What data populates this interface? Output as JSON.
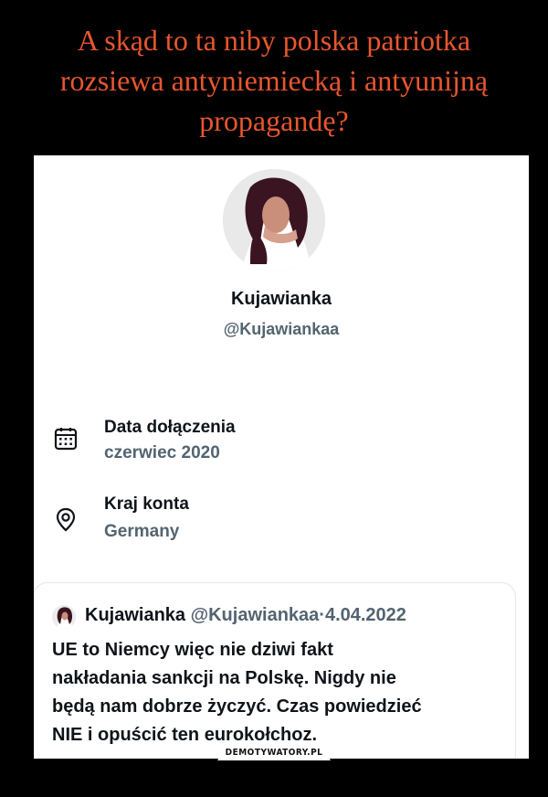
{
  "headline": {
    "lines": [
      "A skąd to ta niby polska patriotka",
      "rozsiewa antyniemiecką i antyunijną",
      "propagandę?"
    ],
    "color": "#e8562f"
  },
  "profile": {
    "name": "Kujawianka",
    "handle": "@Kujawiankaa",
    "joined_label": "Data dołączenia",
    "joined_value": "czerwiec 2020",
    "country_label": "Kraj konta",
    "country_value": "Germany"
  },
  "tweet": {
    "name": "Kujawianka",
    "handle": "@Kujawiankaa",
    "separator": "·",
    "date": "4.04.2022",
    "lines": [
      "UE to Niemcy więc nie dziwi fakt",
      "nakładania sankcji na Polskę. Nigdy nie",
      "będą nam dobrze życzyć. Czas powiedzieć",
      "NIE i opuścić ten eurokołchoz."
    ]
  },
  "watermark": "DEMOTYWATORY.PL",
  "icons": {
    "joined": "calendar-icon",
    "country": "location-pin-icon"
  }
}
